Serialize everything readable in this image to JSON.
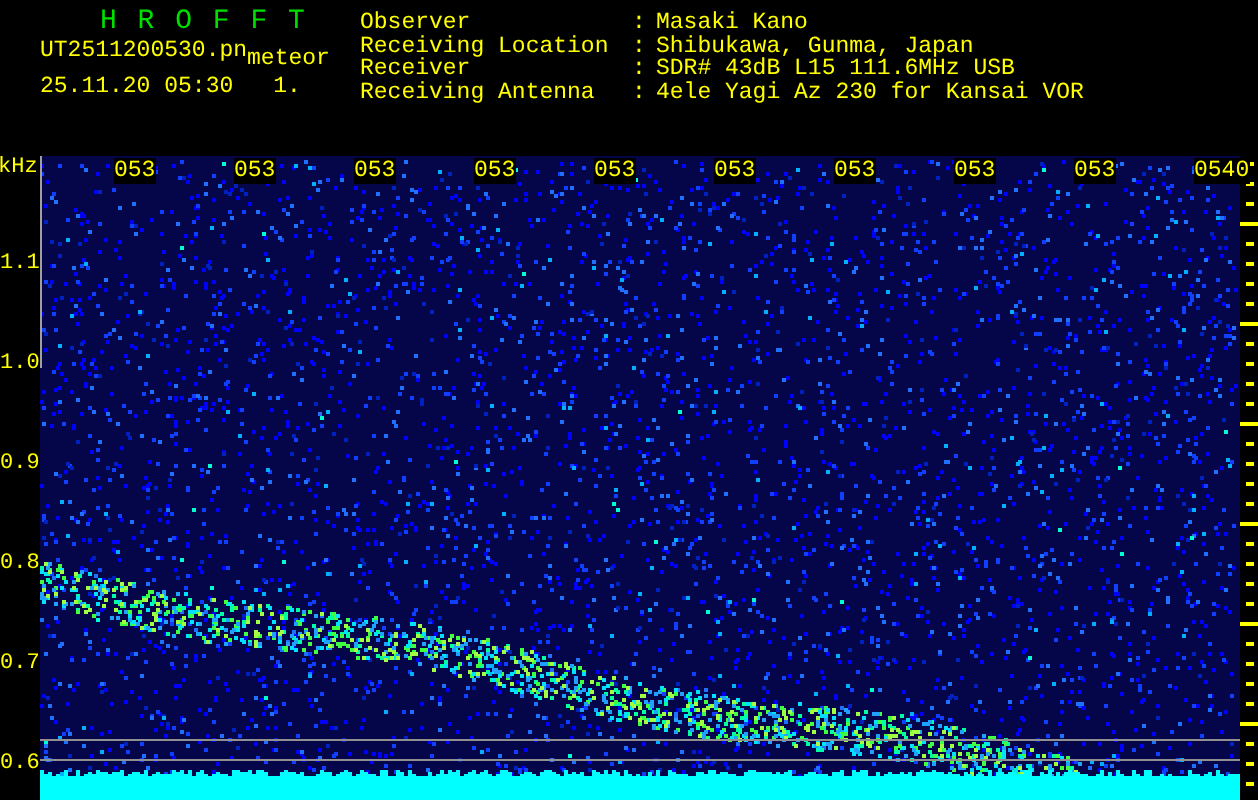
{
  "header": {
    "title": "H R O F F T",
    "file_name": "UT2511200530.pn",
    "tag": "meteor",
    "timestamp": "25.11.20 05:30",
    "counter": "1.",
    "info": [
      {
        "label": "Observer",
        "separator": ":",
        "value": "Masaki Kano"
      },
      {
        "label": "Receiving Location",
        "separator": ":",
        "value": "Shibukawa, Gunma, Japan"
      },
      {
        "label": "Receiver",
        "separator": ":",
        "value": "SDR# 43dB L15 111.6MHz USB"
      },
      {
        "label": "Receiving Antenna",
        "separator": ":",
        "value": "4ele Yagi Az 230 for Kansai VOR"
      }
    ]
  },
  "plot": {
    "unit": "kHz",
    "time_labels": [
      "053",
      "053",
      "053",
      "053",
      "053",
      "053",
      "053",
      "053",
      "053",
      "0540"
    ],
    "freq_labels": [
      "1.1",
      "1.0",
      "0.9",
      "0.8",
      "0.7",
      "0.6"
    ]
  }
}
